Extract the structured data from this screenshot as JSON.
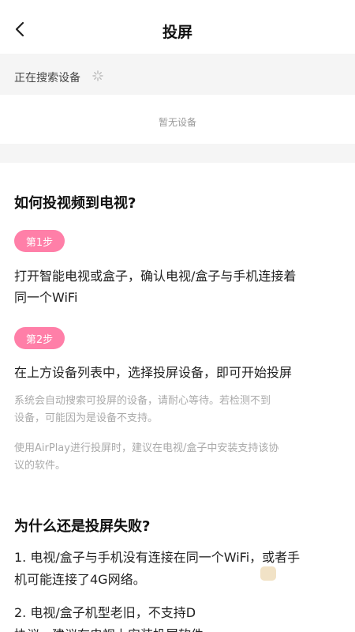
{
  "header": {
    "title": "投屏",
    "back_icon": "chevron-left-icon"
  },
  "search": {
    "status": "正在搜索设备",
    "spinner_icon": "loading-spinner-icon"
  },
  "devices": {
    "empty_text": "暂无设备"
  },
  "guide": {
    "title": "如何投视频到电视?",
    "step1": {
      "badge": "第1步",
      "line1": "打开智能电视或盒子，确认电视/盒子与手机连接着",
      "line2": "同一个WiFi"
    },
    "step2": {
      "badge": "第2步",
      "text": "在上方设备列表中，选择投屏设备，即可开始投屏",
      "note1_line1": "系统会自动搜索可投屏的设备，请耐心等待。若检测不到",
      "note1_line2": "设备，可能因为是设备不支持。",
      "note2_line1": "使用AirPlay进行投屏时，建议在电视/盒子中安装支持该协",
      "note2_line2": "议的软件。"
    }
  },
  "faq": {
    "title": "为什么还是投屏失败?",
    "item1_line1": "1. 电视/盒子与手机没有连接在同一个WiFi，或者手",
    "item1_line2": "机可能连接了4G网络。",
    "item2_line1": "2. 电视/盒子机型老旧，不支持D",
    "item2_line2": "协议，建议在电视上安装投屏软件。"
  },
  "colors": {
    "badge": "#ff7fa8",
    "band": "#f5f5f5",
    "muted": "#aaaaaa"
  }
}
